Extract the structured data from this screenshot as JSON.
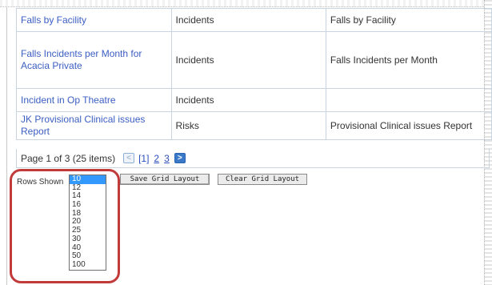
{
  "grid": {
    "rows": [
      {
        "report": "Falls by Facility",
        "module": "Incidents",
        "title": "Falls by Facility"
      },
      {
        "report": "Falls Incidents per Month for Acacia Private",
        "module": "Incidents",
        "title": "Falls Incidents per Month"
      },
      {
        "report": "Incident in Op Theatre",
        "module": "Incidents",
        "title": ""
      },
      {
        "report": "JK Provisional Clinical issues Report",
        "module": "Risks",
        "title": "Provisional Clinical issues Report"
      }
    ]
  },
  "pager": {
    "info": "Page 1 of 3 (25 items)",
    "prev_glyph": "<",
    "pages": [
      "[1]",
      "2",
      "3"
    ],
    "next_glyph": ">"
  },
  "rows_shown": {
    "label": "Rows Shown",
    "selected": "10",
    "options": [
      "10",
      "12",
      "14",
      "16",
      "18",
      "20",
      "25",
      "30",
      "40",
      "50",
      "100"
    ]
  },
  "buttons": {
    "save_label": "Save Grid Layout",
    "clear_label": "Clear Grid Layout"
  },
  "colors": {
    "link": "#3b5ec2",
    "highlight": "#c23b3b",
    "selected_option": "#3399ff"
  }
}
